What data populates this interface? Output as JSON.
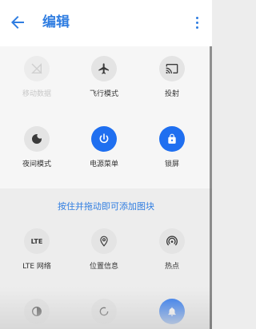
{
  "header": {
    "title": "编辑"
  },
  "active_tiles": [
    {
      "label": "移动数据",
      "icon": "mobile-data-off-icon",
      "state": "disabled"
    },
    {
      "label": "飞行模式",
      "icon": "airplane-icon",
      "state": "off"
    },
    {
      "label": "投射",
      "icon": "cast-icon",
      "state": "off"
    },
    {
      "label": "夜间模式",
      "icon": "night-mode-icon",
      "state": "off"
    },
    {
      "label": "电源菜单",
      "icon": "power-icon",
      "state": "on"
    },
    {
      "label": "锁屏",
      "icon": "lock-icon",
      "state": "on"
    }
  ],
  "hint": "按住并拖动即可添加图块",
  "available_tiles": [
    {
      "label": "LTE 网络",
      "icon_text": "LTE",
      "icon": "lte-icon"
    },
    {
      "label": "位置信息",
      "icon": "location-pin-icon"
    },
    {
      "label": "热点",
      "icon": "hotspot-icon"
    },
    {
      "label": "",
      "icon": "contrast-icon"
    },
    {
      "label": "",
      "icon": "sync-icon"
    },
    {
      "label": "",
      "icon": "notification-bell-icon"
    }
  ],
  "colors": {
    "accent": "#2f7de1",
    "tile_on": "#1f6ff0"
  }
}
